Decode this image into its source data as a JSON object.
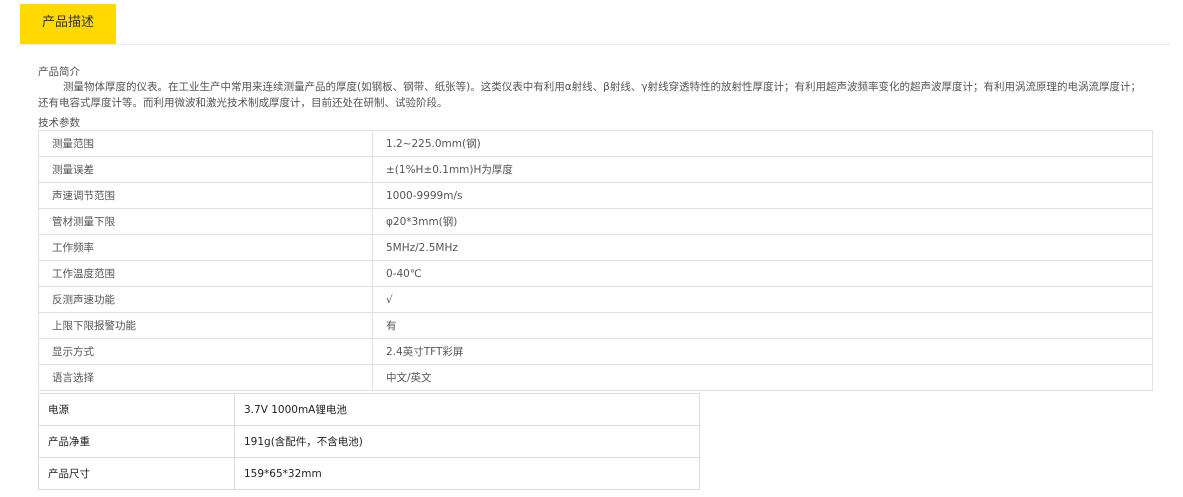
{
  "tab": {
    "label": "产品描述"
  },
  "intro_heading": "产品简介",
  "intro_text": "测量物体厚度的仪表。在工业生产中常用来连续测量产品的厚度(如钢板、钢带、纸张等)。这类仪表中有利用α射线、β射线、γ射线穿透特性的放射性厚度计；有利用超声波频率变化的超声波厚度计；有利用涡流原理的电涡流厚度计；还有电容式厚度计等。而利用微波和激光技术制成厚度计，目前还处在研制、试验阶段。",
  "params_heading": "技术参数",
  "params": [
    {
      "name": "测量范围",
      "value": "1.2~225.0mm(钢)"
    },
    {
      "name": "测量误差",
      "value": "±(1%H±0.1mm)H为厚度"
    },
    {
      "name": "声速调节范围",
      "value": "1000-9999m/s"
    },
    {
      "name": "管材测量下限",
      "value": "φ20*3mm(钢)"
    },
    {
      "name": "工作频率",
      "value": "5MHz/2.5MHz"
    },
    {
      "name": "工作温度范围",
      "value": "0-40℃"
    },
    {
      "name": "反测声速功能",
      "value": "√"
    },
    {
      "name": "上限下限报警功能",
      "value": "有"
    },
    {
      "name": "显示方式",
      "value": "2.4英寸TFT彩屏"
    },
    {
      "name": "语言选择",
      "value": "中文/英文"
    }
  ],
  "extra": [
    {
      "name": "电源",
      "value": "3.7V 1000mA锂电池"
    },
    {
      "name": "产品净重",
      "value": "191g(含配件，不含电池)"
    },
    {
      "name": "产品尺寸",
      "value": "159*65*32mm"
    }
  ]
}
